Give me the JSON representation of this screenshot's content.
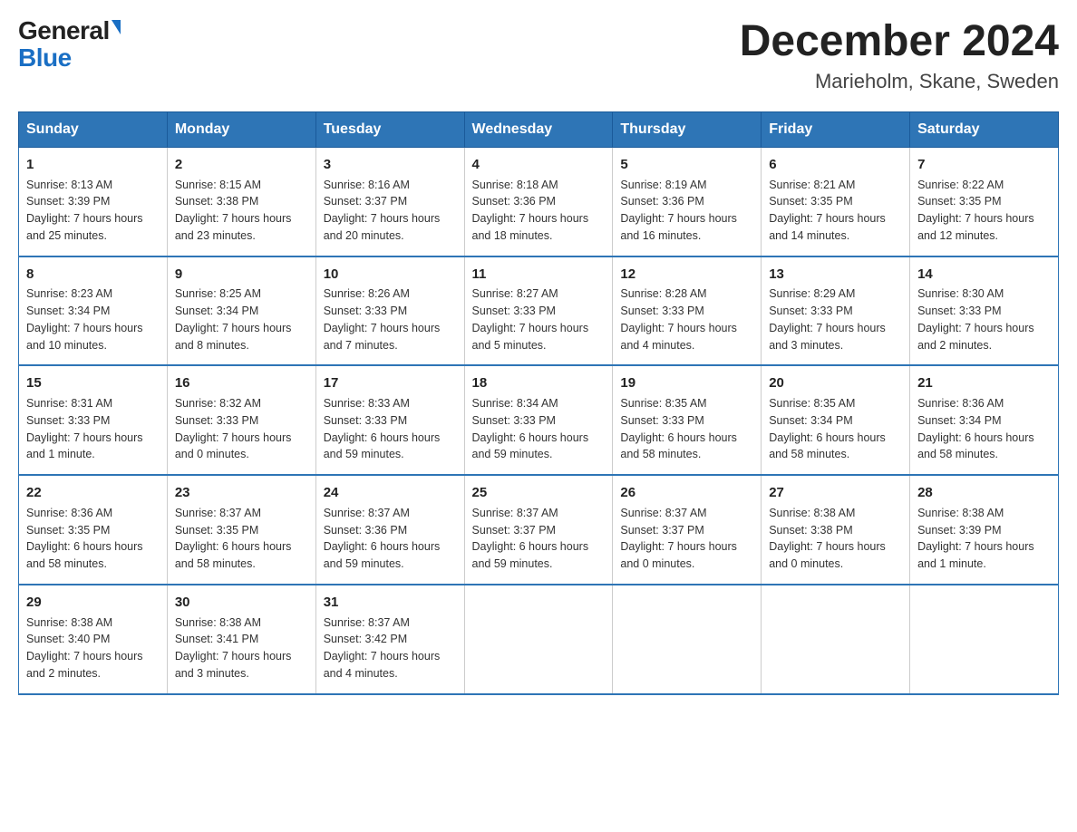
{
  "header": {
    "logo_general": "General",
    "logo_blue": "Blue",
    "month_title": "December 2024",
    "location": "Marieholm, Skane, Sweden"
  },
  "weekdays": [
    "Sunday",
    "Monday",
    "Tuesday",
    "Wednesday",
    "Thursday",
    "Friday",
    "Saturday"
  ],
  "weeks": [
    [
      {
        "day": "1",
        "sunrise": "8:13 AM",
        "sunset": "3:39 PM",
        "daylight": "7 hours and 25 minutes."
      },
      {
        "day": "2",
        "sunrise": "8:15 AM",
        "sunset": "3:38 PM",
        "daylight": "7 hours and 23 minutes."
      },
      {
        "day": "3",
        "sunrise": "8:16 AM",
        "sunset": "3:37 PM",
        "daylight": "7 hours and 20 minutes."
      },
      {
        "day": "4",
        "sunrise": "8:18 AM",
        "sunset": "3:36 PM",
        "daylight": "7 hours and 18 minutes."
      },
      {
        "day": "5",
        "sunrise": "8:19 AM",
        "sunset": "3:36 PM",
        "daylight": "7 hours and 16 minutes."
      },
      {
        "day": "6",
        "sunrise": "8:21 AM",
        "sunset": "3:35 PM",
        "daylight": "7 hours and 14 minutes."
      },
      {
        "day": "7",
        "sunrise": "8:22 AM",
        "sunset": "3:35 PM",
        "daylight": "7 hours and 12 minutes."
      }
    ],
    [
      {
        "day": "8",
        "sunrise": "8:23 AM",
        "sunset": "3:34 PM",
        "daylight": "7 hours and 10 minutes."
      },
      {
        "day": "9",
        "sunrise": "8:25 AM",
        "sunset": "3:34 PM",
        "daylight": "7 hours and 8 minutes."
      },
      {
        "day": "10",
        "sunrise": "8:26 AM",
        "sunset": "3:33 PM",
        "daylight": "7 hours and 7 minutes."
      },
      {
        "day": "11",
        "sunrise": "8:27 AM",
        "sunset": "3:33 PM",
        "daylight": "7 hours and 5 minutes."
      },
      {
        "day": "12",
        "sunrise": "8:28 AM",
        "sunset": "3:33 PM",
        "daylight": "7 hours and 4 minutes."
      },
      {
        "day": "13",
        "sunrise": "8:29 AM",
        "sunset": "3:33 PM",
        "daylight": "7 hours and 3 minutes."
      },
      {
        "day": "14",
        "sunrise": "8:30 AM",
        "sunset": "3:33 PM",
        "daylight": "7 hours and 2 minutes."
      }
    ],
    [
      {
        "day": "15",
        "sunrise": "8:31 AM",
        "sunset": "3:33 PM",
        "daylight": "7 hours and 1 minute."
      },
      {
        "day": "16",
        "sunrise": "8:32 AM",
        "sunset": "3:33 PM",
        "daylight": "7 hours and 0 minutes."
      },
      {
        "day": "17",
        "sunrise": "8:33 AM",
        "sunset": "3:33 PM",
        "daylight": "6 hours and 59 minutes."
      },
      {
        "day": "18",
        "sunrise": "8:34 AM",
        "sunset": "3:33 PM",
        "daylight": "6 hours and 59 minutes."
      },
      {
        "day": "19",
        "sunrise": "8:35 AM",
        "sunset": "3:33 PM",
        "daylight": "6 hours and 58 minutes."
      },
      {
        "day": "20",
        "sunrise": "8:35 AM",
        "sunset": "3:34 PM",
        "daylight": "6 hours and 58 minutes."
      },
      {
        "day": "21",
        "sunrise": "8:36 AM",
        "sunset": "3:34 PM",
        "daylight": "6 hours and 58 minutes."
      }
    ],
    [
      {
        "day": "22",
        "sunrise": "8:36 AM",
        "sunset": "3:35 PM",
        "daylight": "6 hours and 58 minutes."
      },
      {
        "day": "23",
        "sunrise": "8:37 AM",
        "sunset": "3:35 PM",
        "daylight": "6 hours and 58 minutes."
      },
      {
        "day": "24",
        "sunrise": "8:37 AM",
        "sunset": "3:36 PM",
        "daylight": "6 hours and 59 minutes."
      },
      {
        "day": "25",
        "sunrise": "8:37 AM",
        "sunset": "3:37 PM",
        "daylight": "6 hours and 59 minutes."
      },
      {
        "day": "26",
        "sunrise": "8:37 AM",
        "sunset": "3:37 PM",
        "daylight": "7 hours and 0 minutes."
      },
      {
        "day": "27",
        "sunrise": "8:38 AM",
        "sunset": "3:38 PM",
        "daylight": "7 hours and 0 minutes."
      },
      {
        "day": "28",
        "sunrise": "8:38 AM",
        "sunset": "3:39 PM",
        "daylight": "7 hours and 1 minute."
      }
    ],
    [
      {
        "day": "29",
        "sunrise": "8:38 AM",
        "sunset": "3:40 PM",
        "daylight": "7 hours and 2 minutes."
      },
      {
        "day": "30",
        "sunrise": "8:38 AM",
        "sunset": "3:41 PM",
        "daylight": "7 hours and 3 minutes."
      },
      {
        "day": "31",
        "sunrise": "8:37 AM",
        "sunset": "3:42 PM",
        "daylight": "7 hours and 4 minutes."
      },
      null,
      null,
      null,
      null
    ]
  ],
  "labels": {
    "sunrise": "Sunrise:",
    "sunset": "Sunset:",
    "daylight": "Daylight:"
  }
}
